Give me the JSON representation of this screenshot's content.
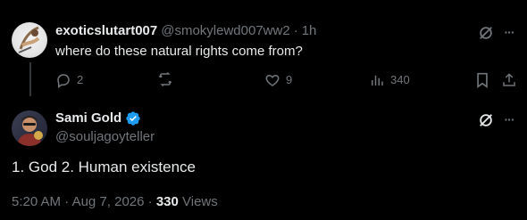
{
  "reply": {
    "display_name": "exoticslutart007",
    "handle": "@smokylewd007ww2",
    "separator": "·",
    "time": "1h",
    "text": "where do these natural rights come from?",
    "actions": {
      "replies": "2",
      "reposts": "",
      "likes": "9",
      "views": "340"
    },
    "more_label": "···"
  },
  "main_tweet": {
    "display_name": "Sami Gold",
    "handle": "@souljagoyteller",
    "text": "1. God 2. Human existence",
    "time": "5:20 AM",
    "separator": "·",
    "date": "Aug 7, 2026",
    "separator2": "·",
    "views_count": "330",
    "views_label": "Views",
    "more_label": "···"
  },
  "colors": {
    "background": "#000000",
    "primary_text": "#e7e9ea",
    "secondary_text": "#71767b",
    "verified_badge": "#1d9bf0",
    "thread_line": "#333639"
  }
}
